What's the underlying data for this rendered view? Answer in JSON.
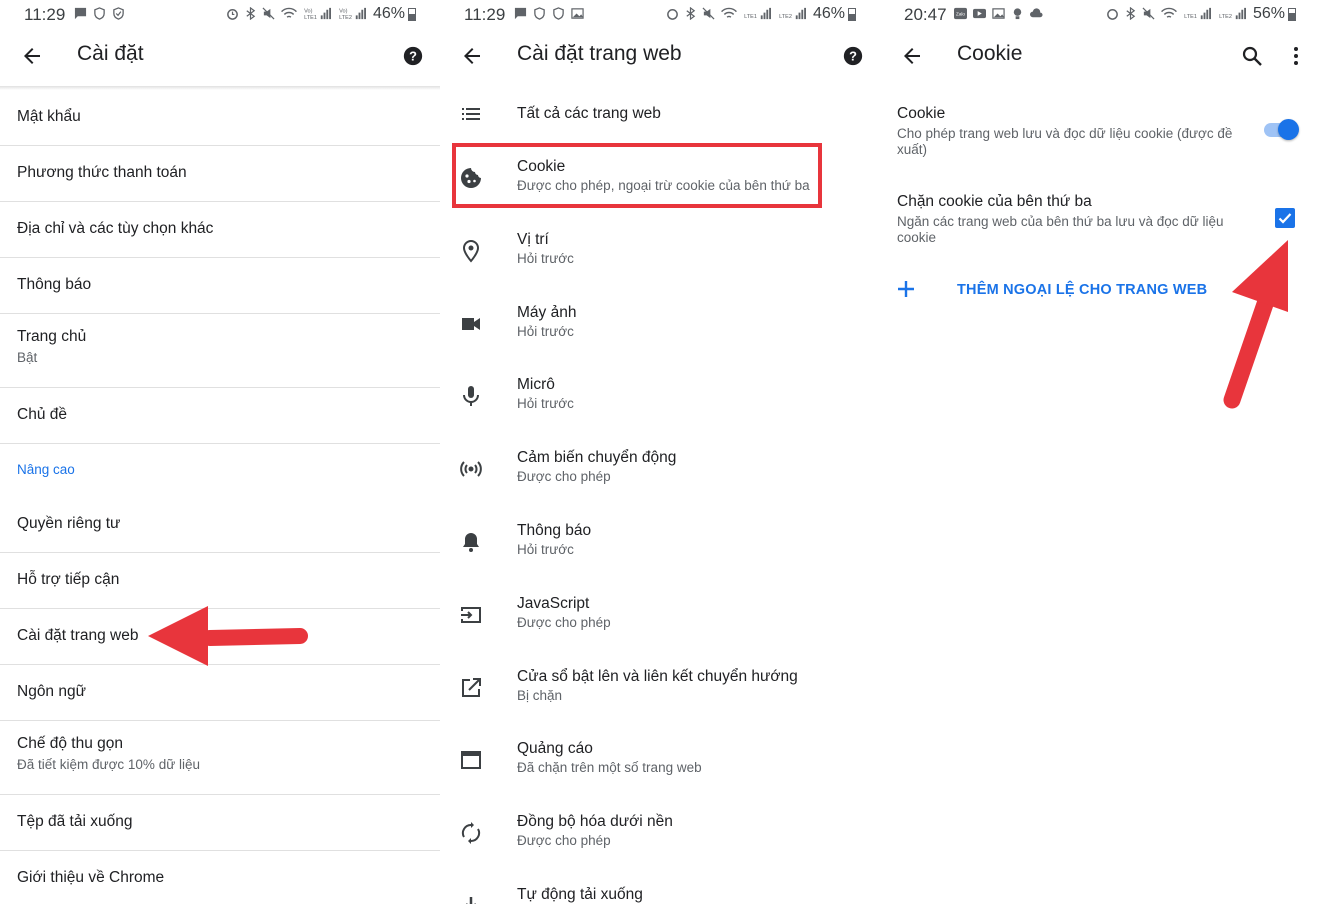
{
  "panel1": {
    "status": {
      "time": "11:29",
      "battery": "46%"
    },
    "title": "Cài đặt",
    "items": [
      {
        "title": "Mật khẩu"
      },
      {
        "title": "Phương thức thanh toán"
      },
      {
        "title": "Địa chỉ và các tùy chọn khác"
      },
      {
        "title": "Thông báo"
      },
      {
        "title": "Trang chủ",
        "subtitle": "Bật"
      },
      {
        "title": "Chủ đề"
      }
    ],
    "section_label": "Nâng cao",
    "advanced_items": [
      {
        "title": "Quyền riêng tư"
      },
      {
        "title": "Hỗ trợ tiếp cận"
      },
      {
        "title": "Cài đặt trang web"
      },
      {
        "title": "Ngôn ngữ"
      },
      {
        "title": "Chế độ thu gọn",
        "subtitle": "Đã tiết kiệm được 10% dữ liệu"
      },
      {
        "title": "Tệp đã tải xuống"
      },
      {
        "title": "Giới thiệu về Chrome"
      }
    ]
  },
  "panel2": {
    "status": {
      "time": "11:29",
      "battery": "46%"
    },
    "title": "Cài đặt trang web",
    "items": [
      {
        "icon": "list-icon",
        "title": "Tất cả các trang web"
      },
      {
        "icon": "cookie-icon",
        "title": "Cookie",
        "subtitle": "Được cho phép, ngoại trừ cookie của bên thứ ba"
      },
      {
        "icon": "location-icon",
        "title": "Vị trí",
        "subtitle": "Hỏi trước"
      },
      {
        "icon": "camera-icon",
        "title": "Máy ảnh",
        "subtitle": "Hỏi trước"
      },
      {
        "icon": "mic-icon",
        "title": "Micrô",
        "subtitle": "Hỏi trước"
      },
      {
        "icon": "sensors-icon",
        "title": "Cảm biến chuyển động",
        "subtitle": "Được cho phép"
      },
      {
        "icon": "bell-icon",
        "title": "Thông báo",
        "subtitle": "Hỏi trước"
      },
      {
        "icon": "javascript-icon",
        "title": "JavaScript",
        "subtitle": "Được cho phép"
      },
      {
        "icon": "popup-icon",
        "title": "Cửa sổ bật lên và liên kết chuyển hướng",
        "subtitle": "Bị chặn"
      },
      {
        "icon": "ads-icon",
        "title": "Quảng cáo",
        "subtitle": "Đã chặn trên một số trang web"
      },
      {
        "icon": "sync-icon",
        "title": "Đồng bộ hóa dưới nền",
        "subtitle": "Được cho phép"
      },
      {
        "icon": "download-icon",
        "title": "Tự động tải xuống"
      }
    ]
  },
  "panel3": {
    "status": {
      "time": "20:47",
      "battery": "56%"
    },
    "title": "Cookie",
    "cookie_option": {
      "title": "Cookie",
      "subtitle": "Cho phép trang web lưu và đọc dữ liệu cookie (được đề xuất)",
      "enabled": true
    },
    "third_party_option": {
      "title": "Chặn cookie của bên thứ ba",
      "subtitle": "Ngăn các trang web của bên thứ ba lưu và đọc dữ liệu cookie",
      "checked": true
    },
    "add_exception_label": "THÊM NGOẠI LỆ CHO TRANG WEB"
  },
  "colors": {
    "accent": "#1a73e8",
    "highlight": "#e8353c",
    "divider": "#e0e0e0"
  }
}
